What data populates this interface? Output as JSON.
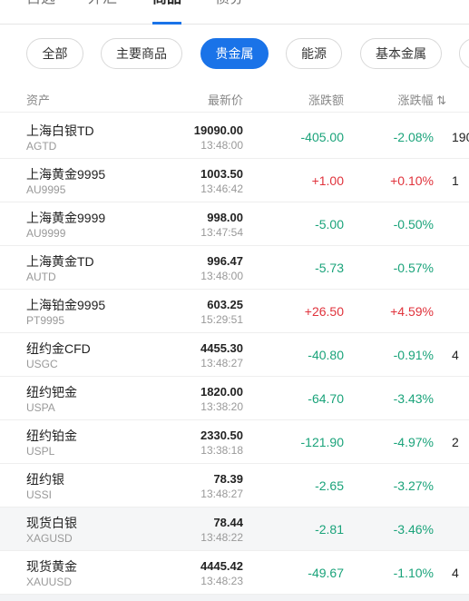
{
  "top_tabs": [
    {
      "label": "自选",
      "active": false
    },
    {
      "label": "外汇",
      "active": false
    },
    {
      "label": "商品",
      "active": true
    },
    {
      "label": "债券",
      "active": false
    }
  ],
  "filters": [
    {
      "label": "全部",
      "active": false
    },
    {
      "label": "主要商品",
      "active": false
    },
    {
      "label": "贵金属",
      "active": true
    },
    {
      "label": "能源",
      "active": false
    },
    {
      "label": "基本金属",
      "active": false
    }
  ],
  "table": {
    "headers": {
      "asset": "资产",
      "price": "最新价",
      "change": "涨跌额",
      "percent": "涨跌幅 ⇅"
    },
    "rows": [
      {
        "name": "上海白银TD",
        "code": "AGTD",
        "price": "19090.00",
        "time": "13:48:00",
        "change": "-405.00",
        "percent": "-2.08%",
        "dir": "down",
        "extra": "190"
      },
      {
        "name": "上海黄金9995",
        "code": "AU9995",
        "price": "1003.50",
        "time": "13:46:42",
        "change": "+1.00",
        "percent": "+0.10%",
        "dir": "up",
        "extra": "1"
      },
      {
        "name": "上海黄金9999",
        "code": "AU9999",
        "price": "998.00",
        "time": "13:47:54",
        "change": "-5.00",
        "percent": "-0.50%",
        "dir": "down",
        "extra": ""
      },
      {
        "name": "上海黄金TD",
        "code": "AUTD",
        "price": "996.47",
        "time": "13:48:00",
        "change": "-5.73",
        "percent": "-0.57%",
        "dir": "down",
        "extra": ""
      },
      {
        "name": "上海铂金9995",
        "code": "PT9995",
        "price": "603.25",
        "time": "15:29:51",
        "change": "+26.50",
        "percent": "+4.59%",
        "dir": "up",
        "extra": ""
      },
      {
        "name": "纽约金CFD",
        "code": "USGC",
        "price": "4455.30",
        "time": "13:48:27",
        "change": "-40.80",
        "percent": "-0.91%",
        "dir": "down",
        "extra": "4"
      },
      {
        "name": "纽约钯金",
        "code": "USPA",
        "price": "1820.00",
        "time": "13:38:20",
        "change": "-64.70",
        "percent": "-3.43%",
        "dir": "down",
        "extra": ""
      },
      {
        "name": "纽约铂金",
        "code": "USPL",
        "price": "2330.50",
        "time": "13:38:18",
        "change": "-121.90",
        "percent": "-4.97%",
        "dir": "down",
        "extra": "2"
      },
      {
        "name": "纽约银",
        "code": "USSI",
        "price": "78.39",
        "time": "13:48:27",
        "change": "-2.65",
        "percent": "-3.27%",
        "dir": "down",
        "extra": ""
      },
      {
        "name": "现货白银",
        "code": "XAGUSD",
        "price": "78.44",
        "time": "13:48:22",
        "change": "-2.81",
        "percent": "-3.46%",
        "dir": "down",
        "extra": ""
      },
      {
        "name": "现货黄金",
        "code": "XAUUSD",
        "price": "4445.42",
        "time": "13:48:23",
        "change": "-49.67",
        "percent": "-1.10%",
        "dir": "down",
        "extra": "4"
      }
    ]
  },
  "colors": {
    "accent": "#1a73e8",
    "up": "#e0333c",
    "down": "#1aa37a"
  }
}
